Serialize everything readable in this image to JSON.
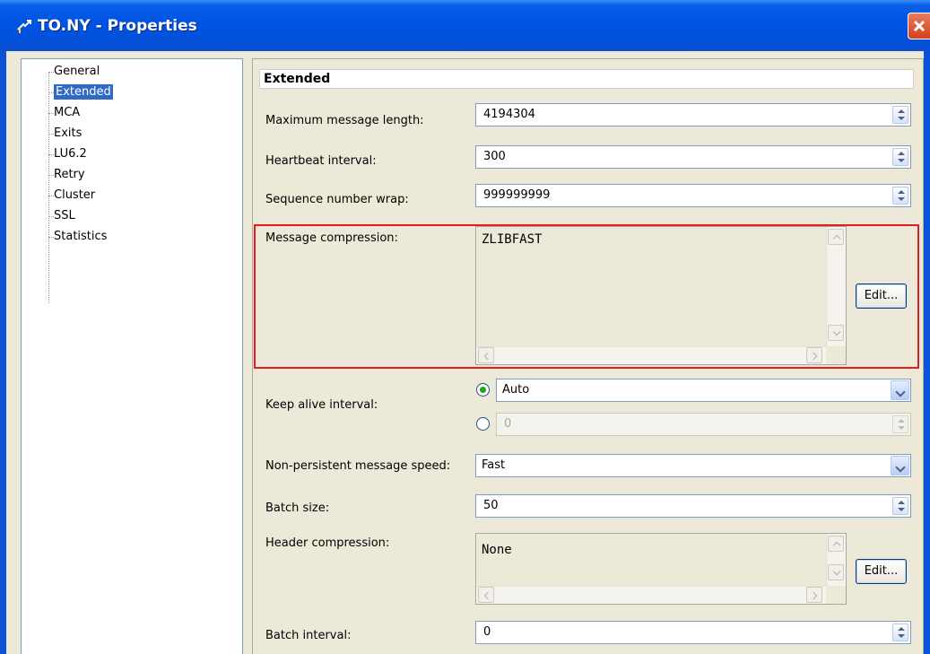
{
  "window": {
    "title": "TO.NY - Properties"
  },
  "tree": {
    "items": [
      {
        "label": "General"
      },
      {
        "label": "Extended"
      },
      {
        "label": "MCA"
      },
      {
        "label": "Exits"
      },
      {
        "label": "LU6.2"
      },
      {
        "label": "Retry"
      },
      {
        "label": "Cluster"
      },
      {
        "label": "SSL"
      },
      {
        "label": "Statistics"
      }
    ],
    "selected": "Extended"
  },
  "panel": {
    "header": "Extended",
    "max_msg_length": {
      "label": "Maximum message length:",
      "value": "4194304"
    },
    "heartbeat": {
      "label": "Heartbeat interval:",
      "value": "300"
    },
    "seq_wrap": {
      "label": "Sequence number wrap:",
      "value": "999999999"
    },
    "msg_compression": {
      "label": "Message compression:",
      "value": "ZLIBFAST",
      "edit_label": "Edit..."
    },
    "keep_alive": {
      "label": "Keep alive interval:",
      "auto_value": "Auto",
      "number_value": "0"
    },
    "np_speed": {
      "label": "Non-persistent message speed:",
      "value": "Fast"
    },
    "batch_size": {
      "label": "Batch size:",
      "value": "50"
    },
    "header_compression": {
      "label": "Header compression:",
      "value": "None",
      "edit_label": "Edit..."
    },
    "batch_interval": {
      "label": "Batch interval:",
      "value": "0"
    }
  },
  "colors": {
    "title_bar": "#0054e3",
    "selection": "#316ac5",
    "highlight_box": "#e02020",
    "radio_dot": "#21a121"
  }
}
